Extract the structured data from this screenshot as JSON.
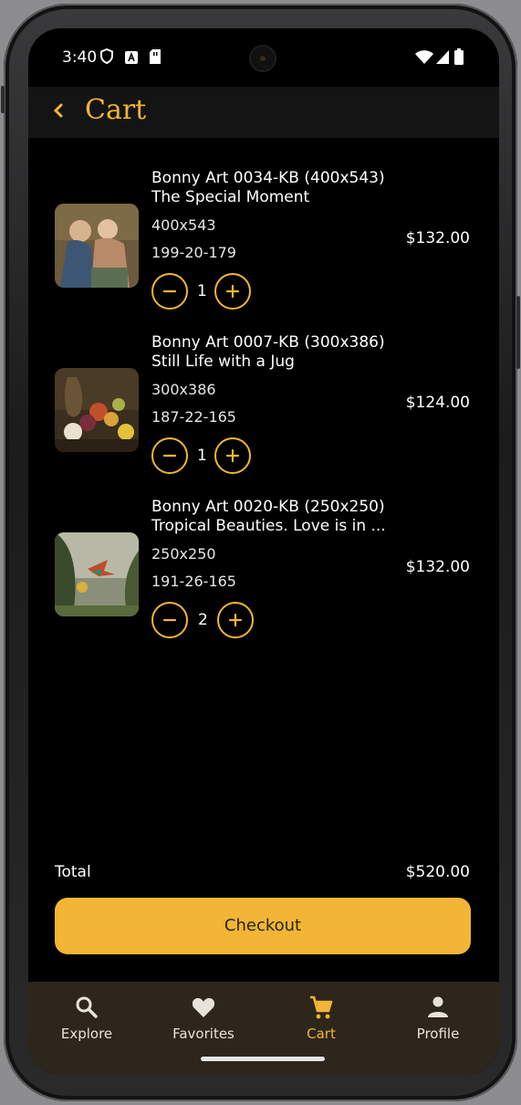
{
  "status_bar": {
    "time": "3:40",
    "left_icons": [
      "shield-icon",
      "a-badge-icon",
      "sim-card-icon"
    ],
    "right_icons": [
      "wifi-icon",
      "signal-icon",
      "battery-icon"
    ]
  },
  "header": {
    "back_icon": "chevron-left-icon",
    "title": "Cart"
  },
  "cart": {
    "items": [
      {
        "name_line1": "Bonny Art 0034-KB (400x543)",
        "name_line2": "The Special Moment",
        "size": "400x543",
        "code": "199-20-179",
        "quantity": "1",
        "price": "$132.00"
      },
      {
        "name_line1": "Bonny Art 0007-KB (300x386)",
        "name_line2": "Still Life with a Jug",
        "size": "300x386",
        "code": "187-22-165",
        "quantity": "1",
        "price": "$124.00"
      },
      {
        "name_line1": "Bonny Art 0020-KB (250x250)",
        "name_line2": "Tropical Beauties. Love is in ...",
        "size": "250x250",
        "code": "191-26-165",
        "quantity": "2",
        "price": "$132.00"
      }
    ],
    "total_label": "Total",
    "total_value": "$520.00",
    "checkout_label": "Checkout"
  },
  "bottom_nav": {
    "items": [
      {
        "label": "Explore",
        "icon": "search-icon",
        "active": false
      },
      {
        "label": "Favorites",
        "icon": "heart-icon",
        "active": false
      },
      {
        "label": "Cart",
        "icon": "cart-icon",
        "active": true
      },
      {
        "label": "Profile",
        "icon": "person-icon",
        "active": false
      }
    ]
  },
  "colors": {
    "accent": "#f2b535",
    "background": "#000000",
    "appbar": "#141414",
    "nav_background": "#2d261c"
  }
}
